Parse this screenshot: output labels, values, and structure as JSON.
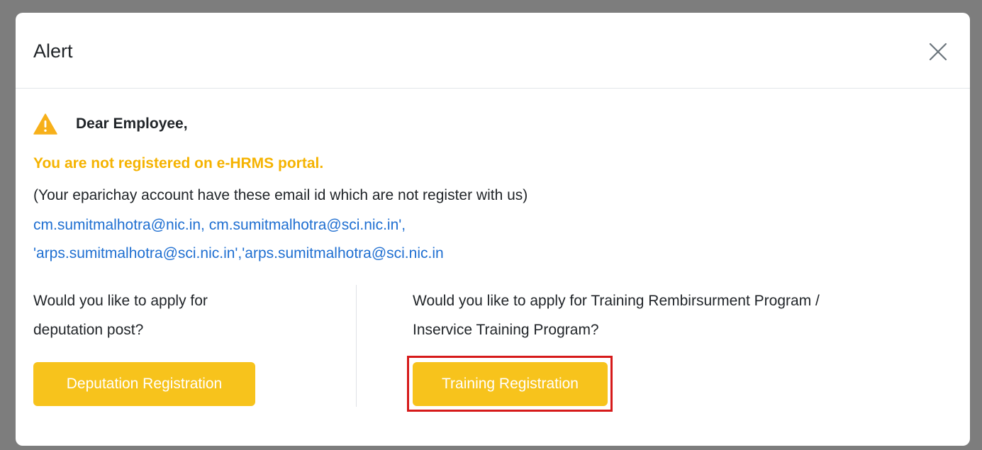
{
  "modal": {
    "title": "Alert",
    "close_icon": "close-icon",
    "greeting": "Dear Employee,",
    "warning_icon": "warning-triangle-icon",
    "not_registered": "You are not registered on e-HRMS portal.",
    "info": "(Your eparichay account have these email id which are not register with us)",
    "emails_line1": "cm.sumitmalhotra@nic.in, cm.sumitmalhotra@sci.nic.in',",
    "emails_line2": "'arps.sumitmalhotra@sci.nic.in','arps.sumitmalhotra@sci.nic.in",
    "left": {
      "question_line1": "Would you like to apply for",
      "question_line2": "deputation post?",
      "button_label": "Deputation Registration"
    },
    "right": {
      "question_line1": "Would you like to apply for Training Rembirsurment Program /",
      "question_line2": "Inservice Training Program?",
      "button_label": "Training Registration"
    }
  },
  "colors": {
    "backdrop": "#7d7d7d",
    "warning_text": "#f5b301",
    "link": "#1f6fd1",
    "button": "#f7c31c",
    "highlight": "#d61a1a"
  }
}
